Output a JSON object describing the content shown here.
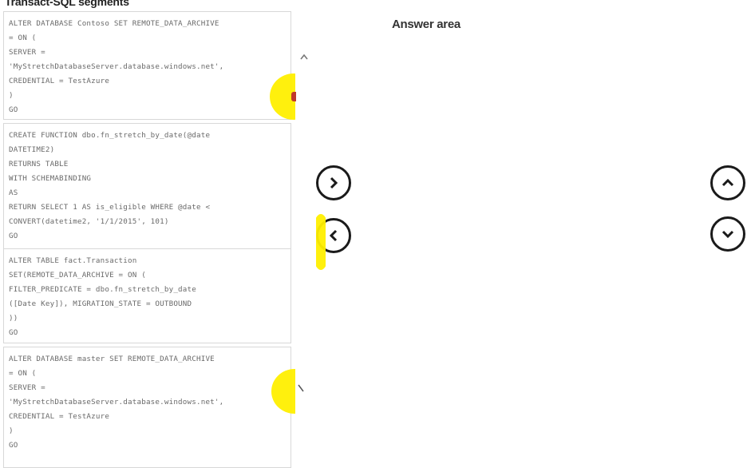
{
  "left_panel": {
    "title": "Transact-SQL segments",
    "segments": [
      {
        "lines": [
          "ALTER DATABASE Contoso SET REMOTE_DATA_ARCHIVE",
          "= ON (",
          "SERVER =",
          "'MyStretchDatabaseServer.database.windows.net',",
          "CREDENTIAL = TestAzure",
          ")",
          "GO"
        ]
      },
      {
        "lines": [
          "CREATE FUNCTION dbo.fn_stretch_by_date(@date",
          "DATETIME2)",
          "RETURNS TABLE",
          "WITH SCHEMABINDING",
          "AS",
          "RETURN SELECT 1 AS is_eligible WHERE @date <",
          "CONVERT(datetime2, '1/1/2015', 101)",
          "GO"
        ]
      },
      {
        "lines": [
          "ALTER TABLE fact.Transaction",
          "SET(REMOTE_DATA_ARCHIVE = ON (",
          "FILTER_PREDICATE = dbo.fn_stretch_by_date",
          "([Date Key]), MIGRATION_STATE = OUTBOUND",
          "))",
          "GO"
        ]
      },
      {
        "lines": [
          "ALTER DATABASE master SET REMOTE_DATA_ARCHIVE",
          "= ON (",
          "SERVER =",
          "'MyStretchDatabaseServer.database.windows.net',",
          "CREDENTIAL = TestAzure",
          ")",
          "GO"
        ]
      }
    ]
  },
  "answer_area": {
    "title": "Answer area",
    "items": []
  },
  "controls": {
    "move_right": "chevron-right-icon",
    "move_left": "chevron-left-icon",
    "move_up": "chevron-up-icon",
    "move_down": "chevron-down-icon"
  },
  "colors": {
    "highlight": "#ffef00",
    "button_stroke": "#1a1a1a",
    "code_text": "#6a6a6a"
  }
}
